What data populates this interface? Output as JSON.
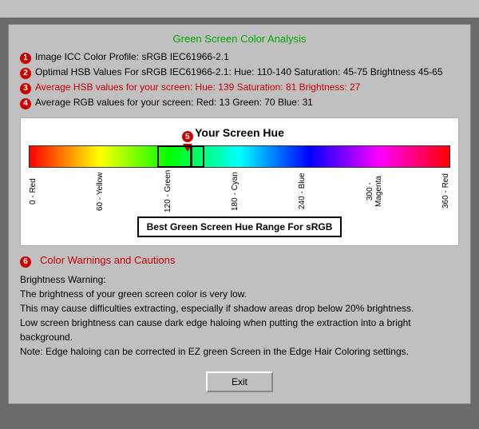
{
  "title": "Green Screen Color Analysis",
  "top_bar": "",
  "rows": [
    {
      "badge": "1",
      "text": "Image ICC Color Profile:  sRGB IEC61966-2.1",
      "highlight": false
    },
    {
      "badge": "2",
      "text": "Optimal HSB Values For sRGB IEC61966-2.1:  Hue: 110-140   Saturation: 45-75   Brightness 45-65",
      "highlight": false
    },
    {
      "badge": "3",
      "text": "Average HSB values for your screen:   Hue: 139   Saturation: 81   Brightness: 27",
      "highlight": true
    },
    {
      "badge": "4",
      "text": "Average RGB values for your screen:   Red: 13   Green: 70   Blue: 31",
      "highlight": false
    }
  ],
  "hue_section": {
    "title": "Your Screen Hue",
    "marker_badge": "5",
    "marker_position_pct": 38.6,
    "green_bracket_start_pct": 30.5,
    "green_bracket_width_pct": 11.1,
    "axis_labels": [
      "0 - Red",
      "60 - Yellow",
      "120 - Green",
      "180 - Cyan",
      "240 - Blue",
      "300 - Magenta",
      "360 - Red"
    ],
    "best_range_label": "Best Green Screen Hue Range For sRGB"
  },
  "warnings": {
    "badge": "6",
    "title": "Color Warnings and Cautions",
    "lines": [
      "Brightness Warning:",
      "The brightness of your green screen color is very low.",
      "This may cause difficulties extracting, especially if shadow areas drop below 20% brightness.",
      "Low screen brightness can cause dark edge haloing when putting the extraction into a bright background.",
      "Note: Edge haloing can be corrected in EZ green Screen in the Edge Hair Coloring settings."
    ]
  },
  "exit_button_label": "Exit"
}
